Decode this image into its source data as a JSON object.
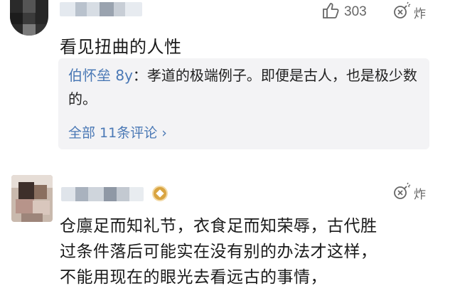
{
  "comment1": {
    "likes": "303",
    "bomb_label": "炸",
    "text": "看见扭曲的人性",
    "reply": {
      "author": "伯怀垒 8y",
      "colon": "：",
      "text": "孝道的极端例子。即便是古人，也是极少数的。",
      "more_link": "全部 11条评论 ›"
    }
  },
  "comment2": {
    "bomb_label": "炸",
    "lines": [
      "仓廪足而知礼节，衣食足而知荣辱，古代胜",
      "过条件落后可能实在没有别的办法才这样，",
      "不能用现在的眼光去看远古的事情，"
    ]
  },
  "colors": {
    "link": "#4a78b5",
    "reply_bg": "#f3f3f5",
    "icon_gray": "#666666",
    "badge_gold": "#d9a441"
  },
  "icons": {
    "like": "thumbs-up-icon",
    "bomb": "bomb-icon",
    "badge": "level-badge-icon"
  }
}
